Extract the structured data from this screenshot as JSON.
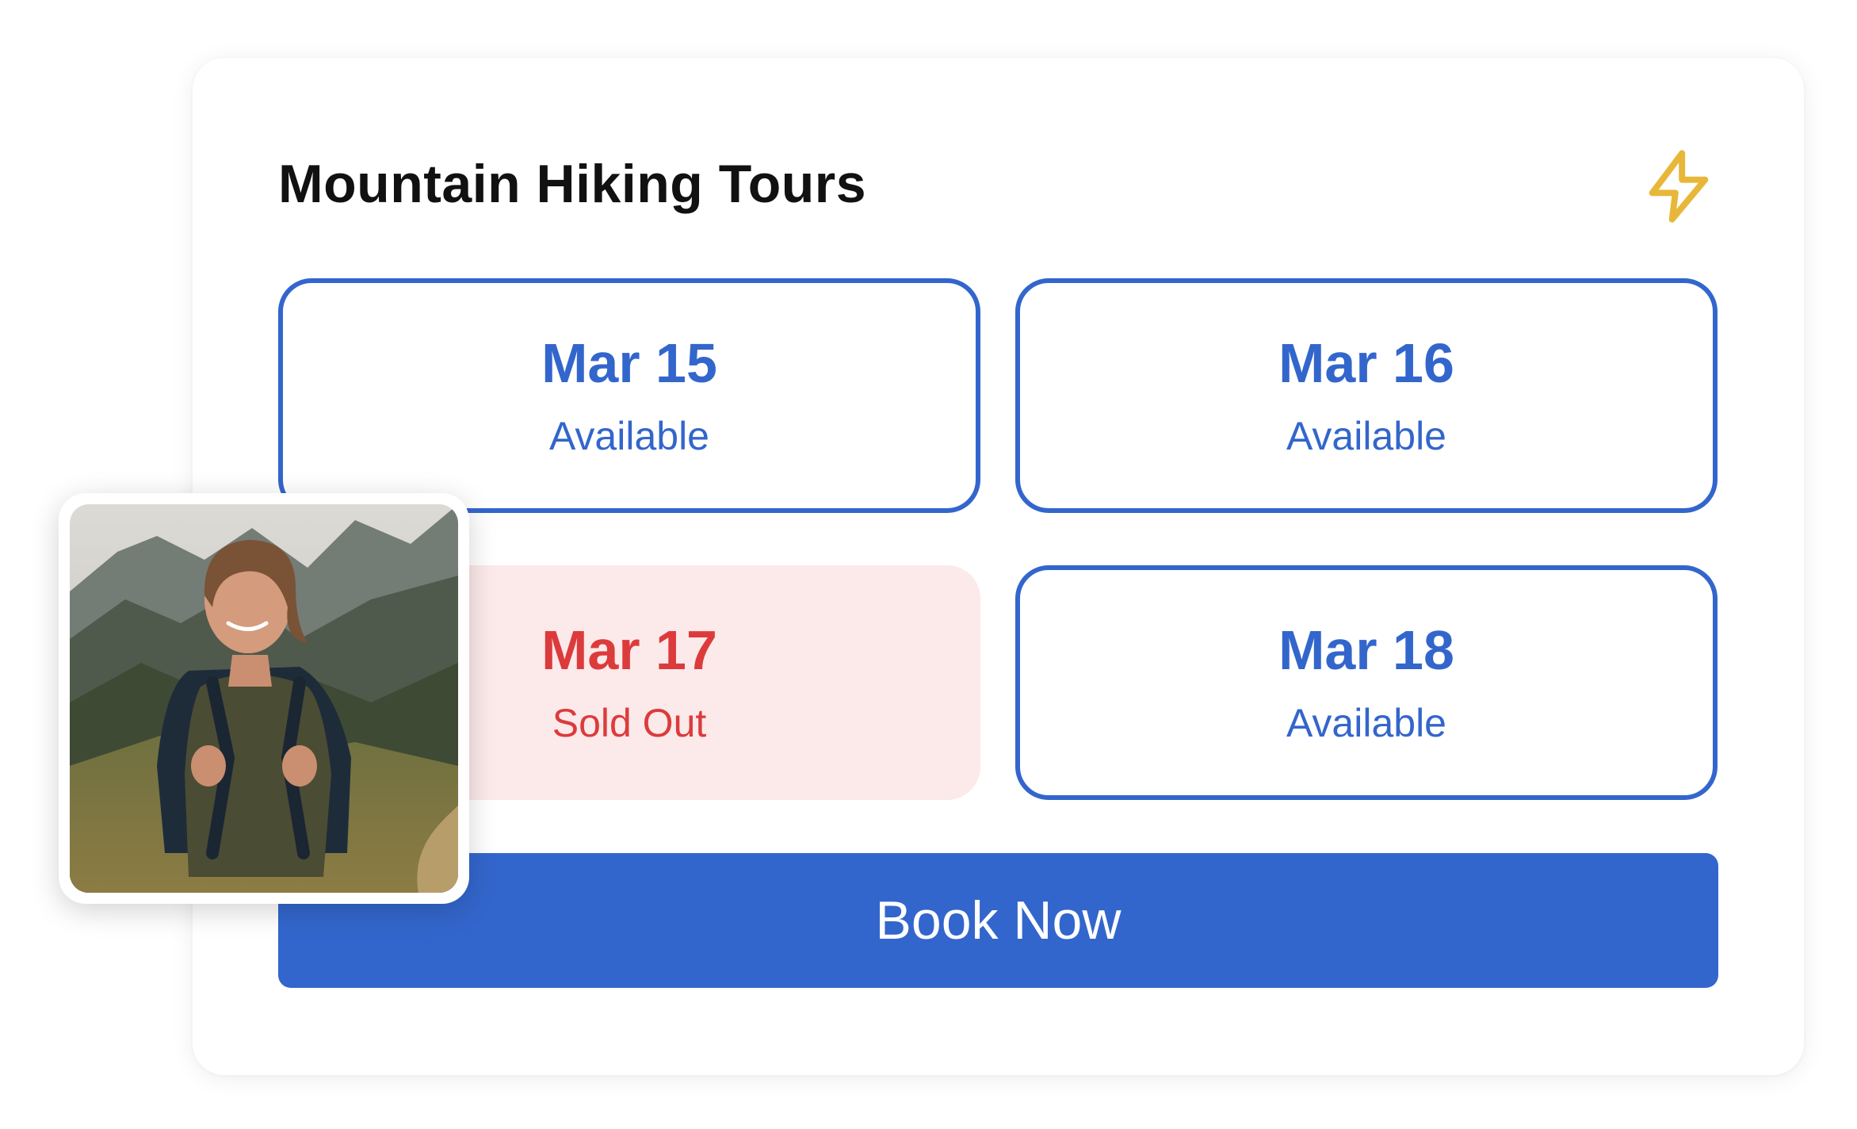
{
  "card": {
    "title": "Mountain Hiking Tours",
    "icon": "lightning-bolt-icon",
    "icon_color": "#e8b73a"
  },
  "dates": [
    {
      "date": "Mar 15",
      "status": "Available"
    },
    {
      "date": "Mar 16",
      "status": "Available"
    },
    {
      "date": "Mar 17",
      "status": "Sold Out"
    },
    {
      "date": "Mar 18",
      "status": "Available"
    }
  ],
  "book_button": {
    "label": "Book Now"
  },
  "photo": {
    "subject": "hiker-photo"
  },
  "colors": {
    "accent": "#3366cc",
    "sold_out_text": "#dc3b3b",
    "sold_out_bg": "#fce9ea"
  }
}
